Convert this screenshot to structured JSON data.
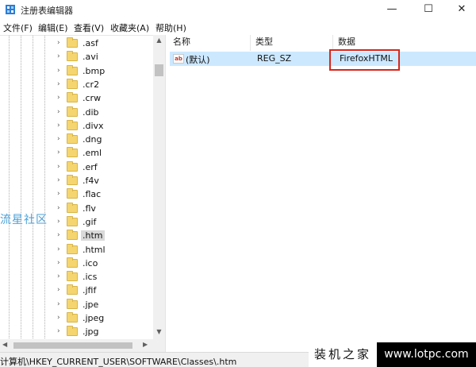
{
  "window": {
    "title": "注册表编辑器",
    "controls": {
      "minimize": "—",
      "maximize": "☐",
      "close": "✕"
    }
  },
  "menu": [
    {
      "label": "文件(F)"
    },
    {
      "label": "编辑(E)"
    },
    {
      "label": "查看(V)"
    },
    {
      "label": "收藏夹(A)"
    },
    {
      "label": "帮助(H)"
    }
  ],
  "tree": {
    "items": [
      {
        "label": ".asf"
      },
      {
        "label": ".avi"
      },
      {
        "label": ".bmp"
      },
      {
        "label": ".cr2"
      },
      {
        "label": ".crw"
      },
      {
        "label": ".dib"
      },
      {
        "label": ".divx"
      },
      {
        "label": ".dng"
      },
      {
        "label": ".eml"
      },
      {
        "label": ".erf"
      },
      {
        "label": ".f4v"
      },
      {
        "label": ".flac"
      },
      {
        "label": ".flv"
      },
      {
        "label": ".gif"
      },
      {
        "label": ".htm",
        "selected": true
      },
      {
        "label": ".html"
      },
      {
        "label": ".ico"
      },
      {
        "label": ".ics"
      },
      {
        "label": ".jfif"
      },
      {
        "label": ".jpe"
      },
      {
        "label": ".jpeg"
      },
      {
        "label": ".jpg"
      }
    ],
    "chevron": "›",
    "folder_color": "#f5d56f"
  },
  "values": {
    "columns": {
      "name": "名称",
      "type": "类型",
      "data": "数据"
    },
    "rows": [
      {
        "icon": "ab",
        "name": "(默认)",
        "type": "REG_SZ",
        "data": "FirefoxHTML"
      }
    ],
    "highlight_color": "#d9261c"
  },
  "statusbar": {
    "path": "计算机\\HKEY_CURRENT_USER\\SOFTWARE\\Classes\\.htm"
  },
  "watermarks": {
    "left": "流星社区",
    "brand": "装机之家",
    "url": "www.lotpc.com"
  },
  "colors": {
    "selection": "#cce8ff",
    "tree_selected": "#d9d9d9",
    "watermark_blue": "#4aa0d8"
  }
}
